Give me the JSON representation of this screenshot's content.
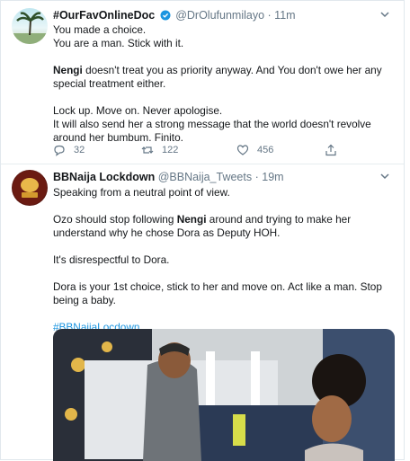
{
  "tweets": [
    {
      "name": "#OurFavOnlineDoc",
      "handle": "@DrOlufunmilayo",
      "dot": "·",
      "time": "11m",
      "lines": [
        "You made a choice.\nYou are a man. Stick with it.",
        "doesn't treat you as priority anyway. And You don't owe her any special treatment either.",
        "Lock up. Move on. Never apologise.\nIt will also send her a strong message that the world doesn't revolve around her bumbum. Finito."
      ],
      "bold_name": "Nengi",
      "actions": {
        "replies": "32",
        "retweets": "122",
        "likes": "456"
      }
    },
    {
      "name": "BBNaija Lockdown",
      "handle": "@BBNaija_Tweets",
      "dot": "·",
      "time": "19m",
      "lines": [
        "Speaking from a neutral point of view.",
        "Ozo should stop following ",
        " around and trying to make her understand why he chose Dora as Deputy HOH.",
        "It's disrespectful to Dora.",
        "Dora is your 1st choice, stick to her and move on. Act like a man. Stop being a baby."
      ],
      "bold_name": "Nengi",
      "hashtag": "#BBNaijaLocdown"
    }
  ],
  "colors": {
    "accent": "#1b95e0",
    "muted": "#657786",
    "border": "#e6ecf0"
  },
  "icons": [
    "reply-icon",
    "retweet-icon",
    "like-icon",
    "share-icon",
    "more-icon",
    "verified-icon"
  ]
}
